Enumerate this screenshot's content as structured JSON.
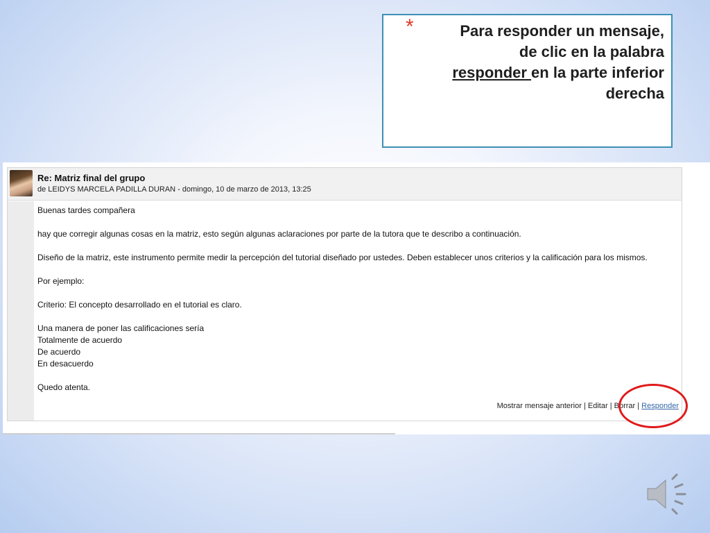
{
  "callout": {
    "bullet": "*",
    "line1": "Para responder un mensaje,",
    "line2": "de clic en la palabra",
    "underlined": "responder ",
    "line3_rest": "en la parte inferior",
    "line4": "derecha"
  },
  "post": {
    "subject": "Re: Matriz final del grupo",
    "byline": "de LEIDYS MARCELA PADILLA DURAN - domingo, 10 de marzo de 2013, 13:25",
    "body": {
      "p1": "Buenas tardes compañera",
      "p2": "hay que corregir algunas cosas en la matriz, esto según algunas aclaraciones por parte de la tutora que te describo a continuación.",
      "p3": "Diseño de la matriz, este instrumento permite medir la percepción del tutorial diseñado por ustedes. Deben establecer unos criterios y la calificación para los mismos.",
      "p4": "Por ejemplo:",
      "p5": "Criterio: El concepto desarrollado en el tutorial es claro.",
      "p6a": "Una manera de poner las calificaciones sería",
      "p6b": "Totalmente de acuerdo",
      "p6c": "De acuerdo",
      "p6d": "En desacuerdo",
      "p7": "Quedo atenta."
    },
    "actions": {
      "previous": "Mostrar mensaje anterior",
      "sep": " | ",
      "edit": "Editar",
      "delete": "Borrar",
      "reply": "Responder"
    }
  },
  "icons": {
    "speaker": "speaker-icon"
  },
  "colors": {
    "highlight_circle": "#e01a1a",
    "callout_border": "#3d8fb6",
    "bullet": "#e03a2a",
    "link": "#3566a8"
  }
}
